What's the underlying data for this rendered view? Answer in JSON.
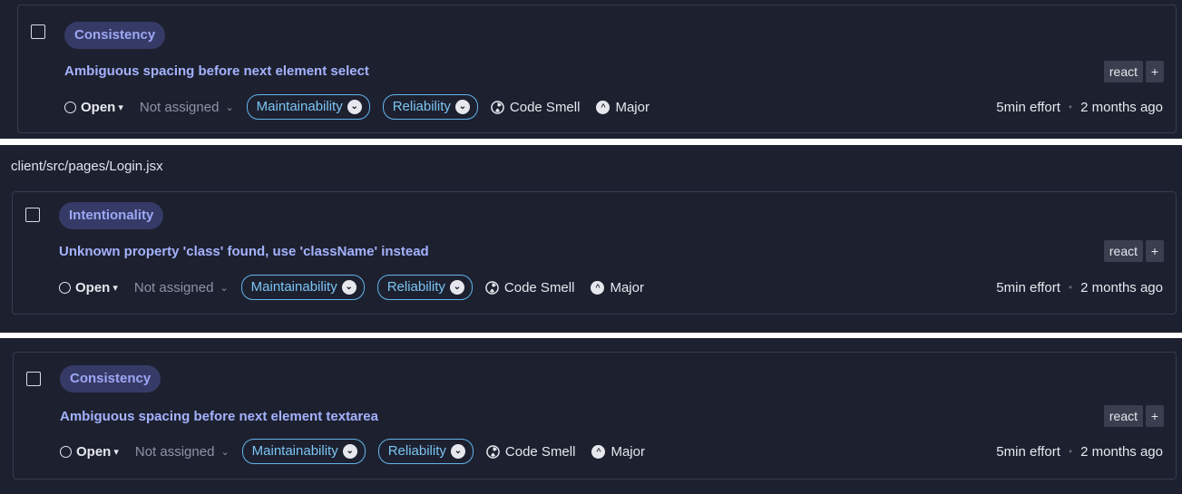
{
  "file_path": "client/src/pages/Login.jsx",
  "issues": [
    {
      "category": "Consistency",
      "title": "Ambiguous spacing before next element select",
      "tag": "react",
      "tag_add": "+",
      "status": "Open",
      "assignee": "Not assigned",
      "qualities": [
        "Maintainability",
        "Reliability"
      ],
      "type": "Code Smell",
      "severity": "Major",
      "effort": "5min effort",
      "age": "2 months ago"
    },
    {
      "category": "Intentionality",
      "title": "Unknown property 'class' found, use 'className' instead",
      "tag": "react",
      "tag_add": "+",
      "status": "Open",
      "assignee": "Not assigned",
      "qualities": [
        "Maintainability",
        "Reliability"
      ],
      "type": "Code Smell",
      "severity": "Major",
      "effort": "5min effort",
      "age": "2 months ago"
    },
    {
      "category": "Consistency",
      "title": "Ambiguous spacing before next element textarea",
      "tag": "react",
      "tag_add": "+",
      "status": "Open",
      "assignee": "Not assigned",
      "qualities": [
        "Maintainability",
        "Reliability"
      ],
      "type": "Code Smell",
      "severity": "Major",
      "effort": "5min effort",
      "age": "2 months ago"
    }
  ],
  "icons": {
    "status": "open-circle-icon",
    "dropdown": "chevron-down-icon",
    "quality": "chevron-down-circle-icon",
    "type": "code-smell-icon",
    "severity": "major-severity-icon"
  },
  "colors": {
    "background": "#1d212f",
    "title": "#a4b2ff",
    "category_pill": "#363a66",
    "quality_border": "#63b3ed"
  }
}
